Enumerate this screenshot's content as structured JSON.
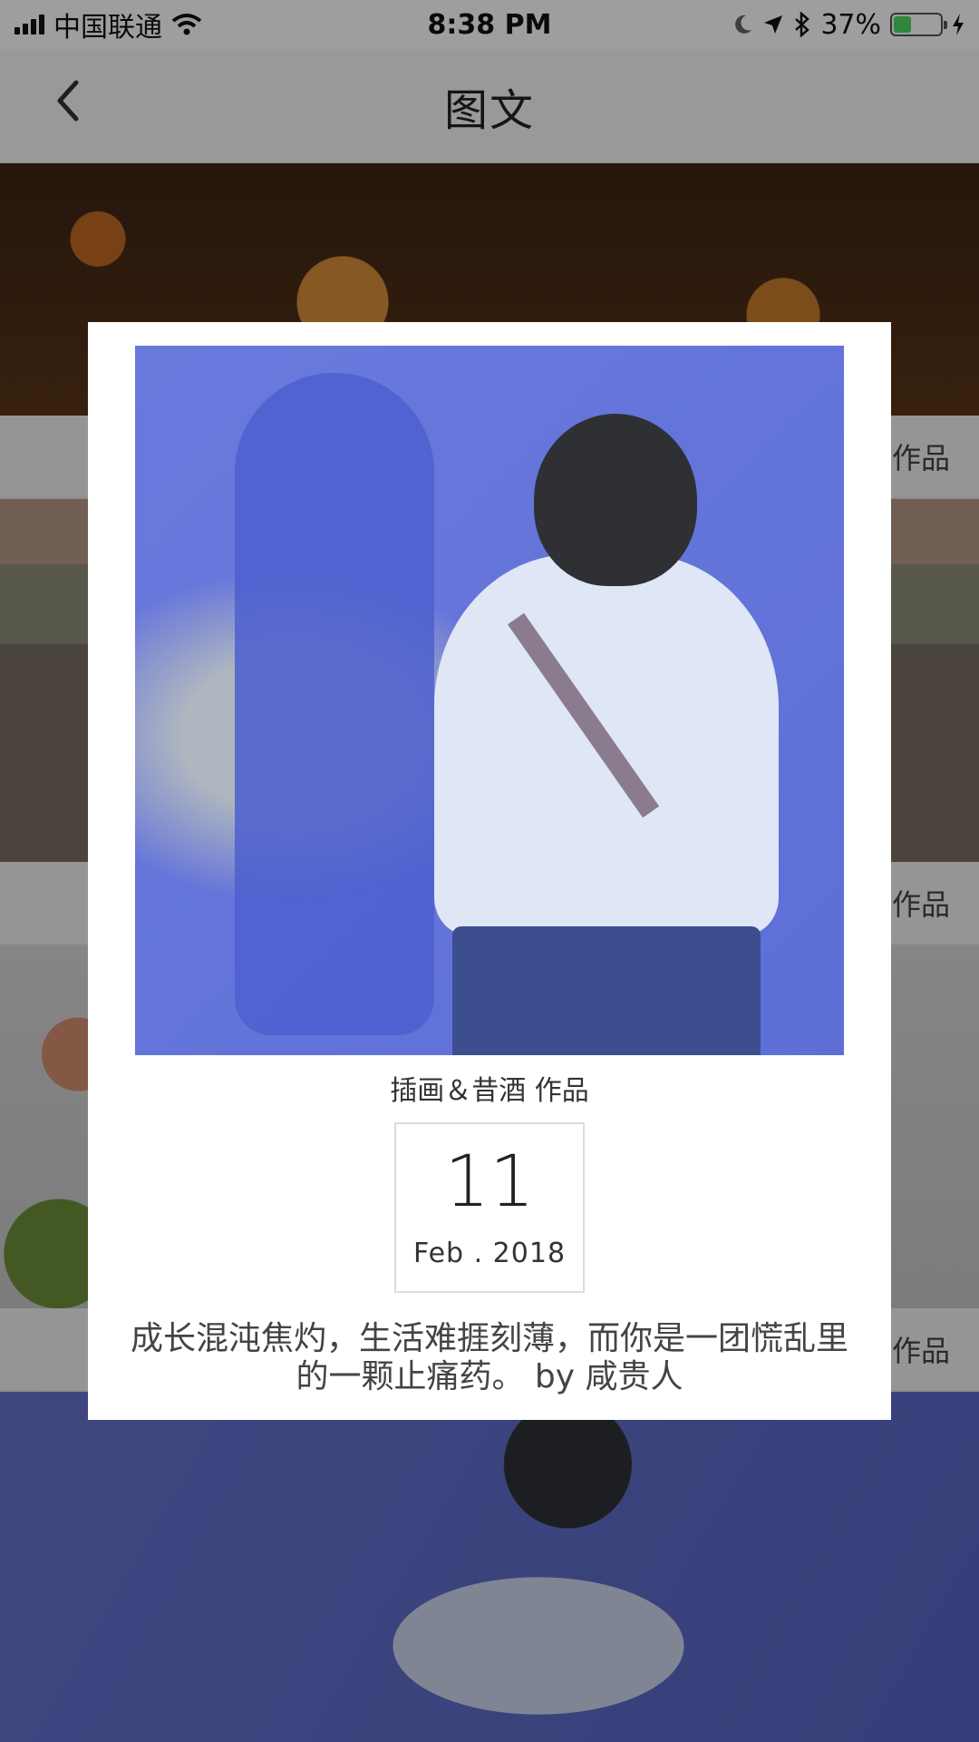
{
  "status_bar": {
    "carrier": "中国联通",
    "time": "8:38 PM",
    "battery_percent": "37%",
    "battery_level": 0.37,
    "icons": [
      "signal-icon",
      "wifi-icon",
      "moon-icon",
      "location-icon",
      "bluetooth-icon",
      "battery-icon",
      "charging-icon"
    ]
  },
  "nav": {
    "title": "图文",
    "back_icon": "chevron-left-icon"
  },
  "feed": {
    "cards": [
      {
        "caption": "作品",
        "image": "autumn-foxes-illustration"
      },
      {
        "caption": "作品",
        "image": "street-drawing-illustration"
      },
      {
        "caption": "作品",
        "image": "roses-still-life-photo"
      },
      {
        "caption": "",
        "image": "girl-with-shadow-illustration"
      }
    ]
  },
  "modal": {
    "author": "插画＆昔酒  作品",
    "day": "11",
    "month_year": "Feb . 2018",
    "quote": "成长混沌焦灼，生活难捱刻薄，而你是一团慌乱里的一颗止痛药。 by 咸贵人",
    "image": "girl-with-shadow-illustration"
  },
  "colors": {
    "overlay": "rgba(0,0,0,0.38)",
    "modal_bg": "#ffffff",
    "battery_green": "#4cd964",
    "illustration_blue": "#5d6fd7"
  }
}
